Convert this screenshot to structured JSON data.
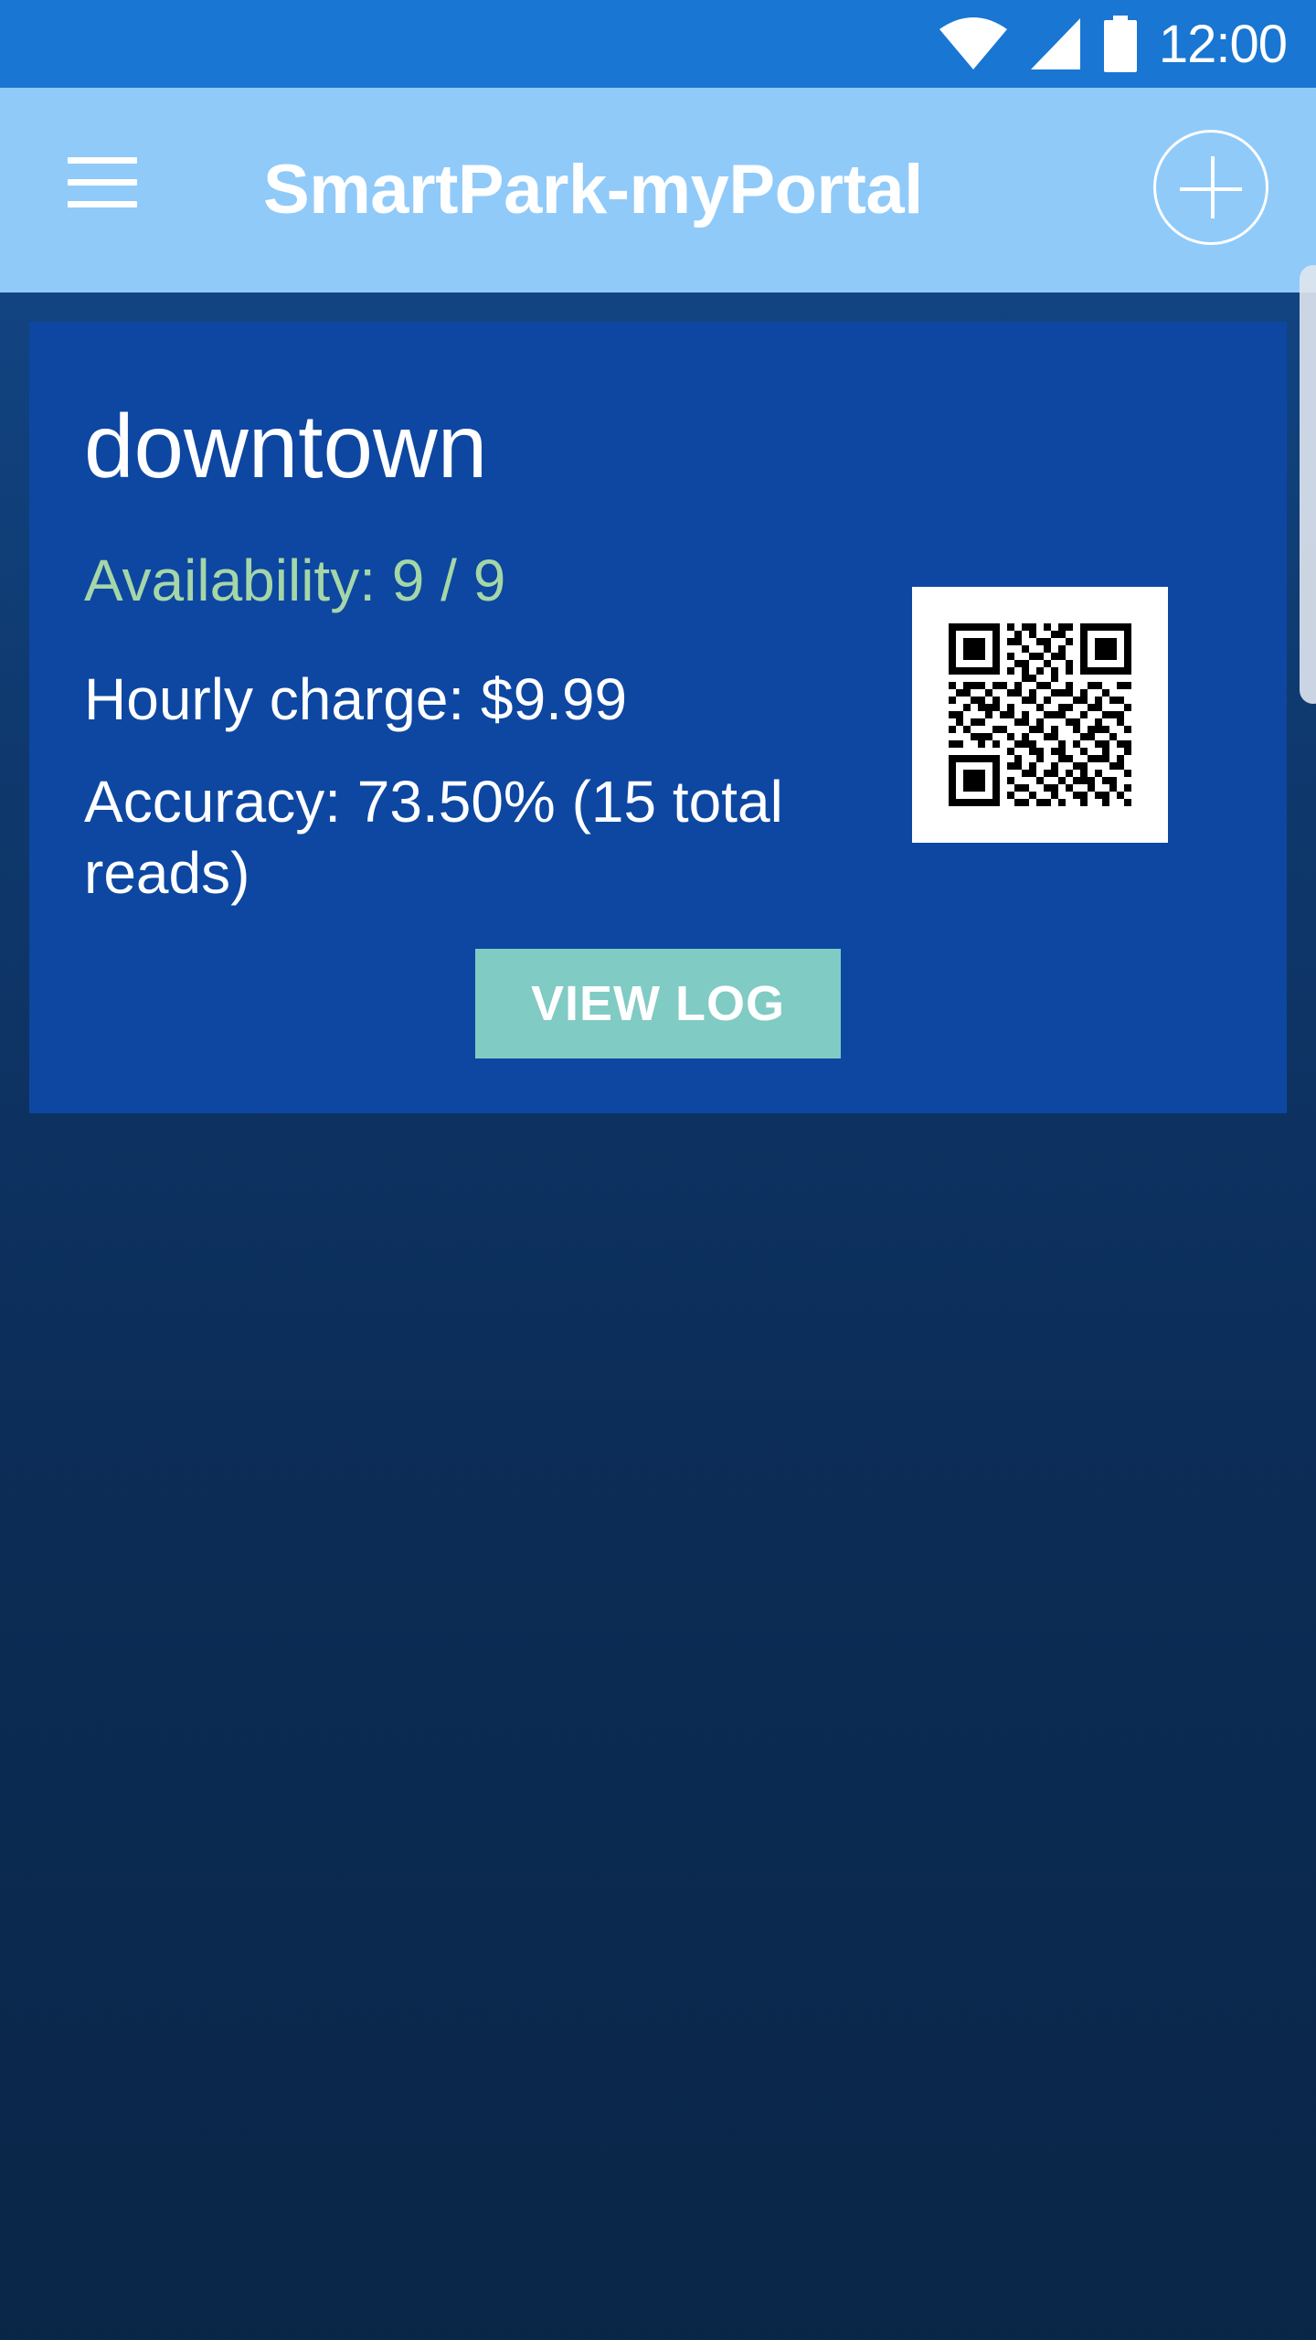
{
  "status_bar": {
    "time": "12:00",
    "icons": [
      "wifi-icon",
      "cell-signal-icon",
      "battery-icon"
    ]
  },
  "app_bar": {
    "title": "SmartPark-myPortal",
    "menu_icon": "hamburger-menu-icon",
    "add_icon": "add-circle-icon"
  },
  "lot_card": {
    "name": "downtown",
    "availability": "Availability: 9 / 9",
    "hourly_charge": "Hourly charge: $9.99",
    "accuracy": "Accuracy: 73.50% (15 total reads)",
    "qr_icon": "qr-code-icon",
    "view_log_label": "VIEW LOG"
  },
  "colors": {
    "status_bar": "#1976d2",
    "app_bar": "#90caf9",
    "card": "#0d47a1",
    "availability_text": "#a5d6a7",
    "button": "#80cbc4"
  }
}
